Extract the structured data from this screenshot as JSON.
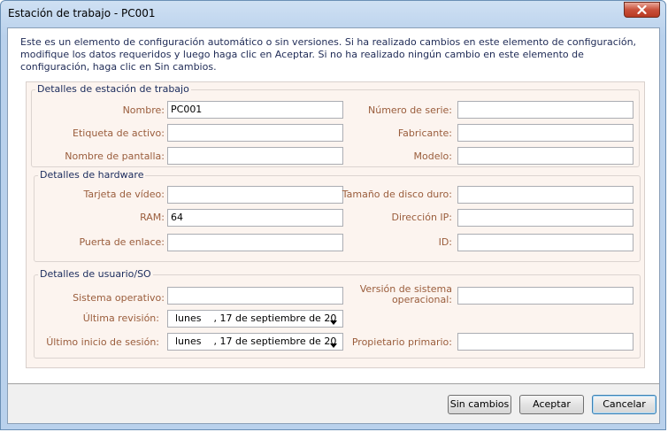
{
  "window": {
    "title": "Estación de trabajo - PC001",
    "close_icon": "close-icon"
  },
  "description": "Este es un elemento de configuración automático o sin versiones. Si ha realizado cambios en este elemento de configuración, modifique los datos requeridos y luego haga clic en Aceptar. Si no ha realizado ningún cambio en este elemento de configuración, haga clic en Sin cambios.",
  "workstation": {
    "title": "Detalles de estación de trabajo",
    "name_label": "Nombre:",
    "name_value": "PC001",
    "serial_label": "Número de serie:",
    "serial_value": "",
    "asset_label": "Etiqueta de activo:",
    "asset_value": "",
    "maker_label": "Fabricante:",
    "maker_value": "",
    "display_label": "Nombre de pantalla:",
    "display_value": "",
    "model_label": "Modelo:",
    "model_value": ""
  },
  "hardware": {
    "title": "Detalles de hardware",
    "video_label": "Tarjeta de vídeo:",
    "video_value": "",
    "disk_label": "Tamaño de disco duro:",
    "disk_value": "",
    "ram_label": "RAM:",
    "ram_value": "64",
    "ip_label": "Dirección IP:",
    "ip_value": "",
    "gateway_label": "Puerta de enlace:",
    "gateway_value": "",
    "id_label": "ID:",
    "id_value": ""
  },
  "user_os": {
    "title": "Detalles de usuario/SO",
    "os_label": "Sistema operativo:",
    "os_value": "",
    "os_version_label": "Versión de sistema operacional:",
    "os_version_value": "",
    "last_review_label": "Última revisión:",
    "last_review_value": "lunes    , 17 de septiembre de 20",
    "last_login_label": "Último inicio de sesión:",
    "last_login_value": "lunes    , 17 de septiembre de 20",
    "owner_label": "Propietario primario:",
    "owner_value": ""
  },
  "buttons": {
    "no_changes": "Sin cambios",
    "accept": "Aceptar",
    "cancel": "Cancelar"
  }
}
